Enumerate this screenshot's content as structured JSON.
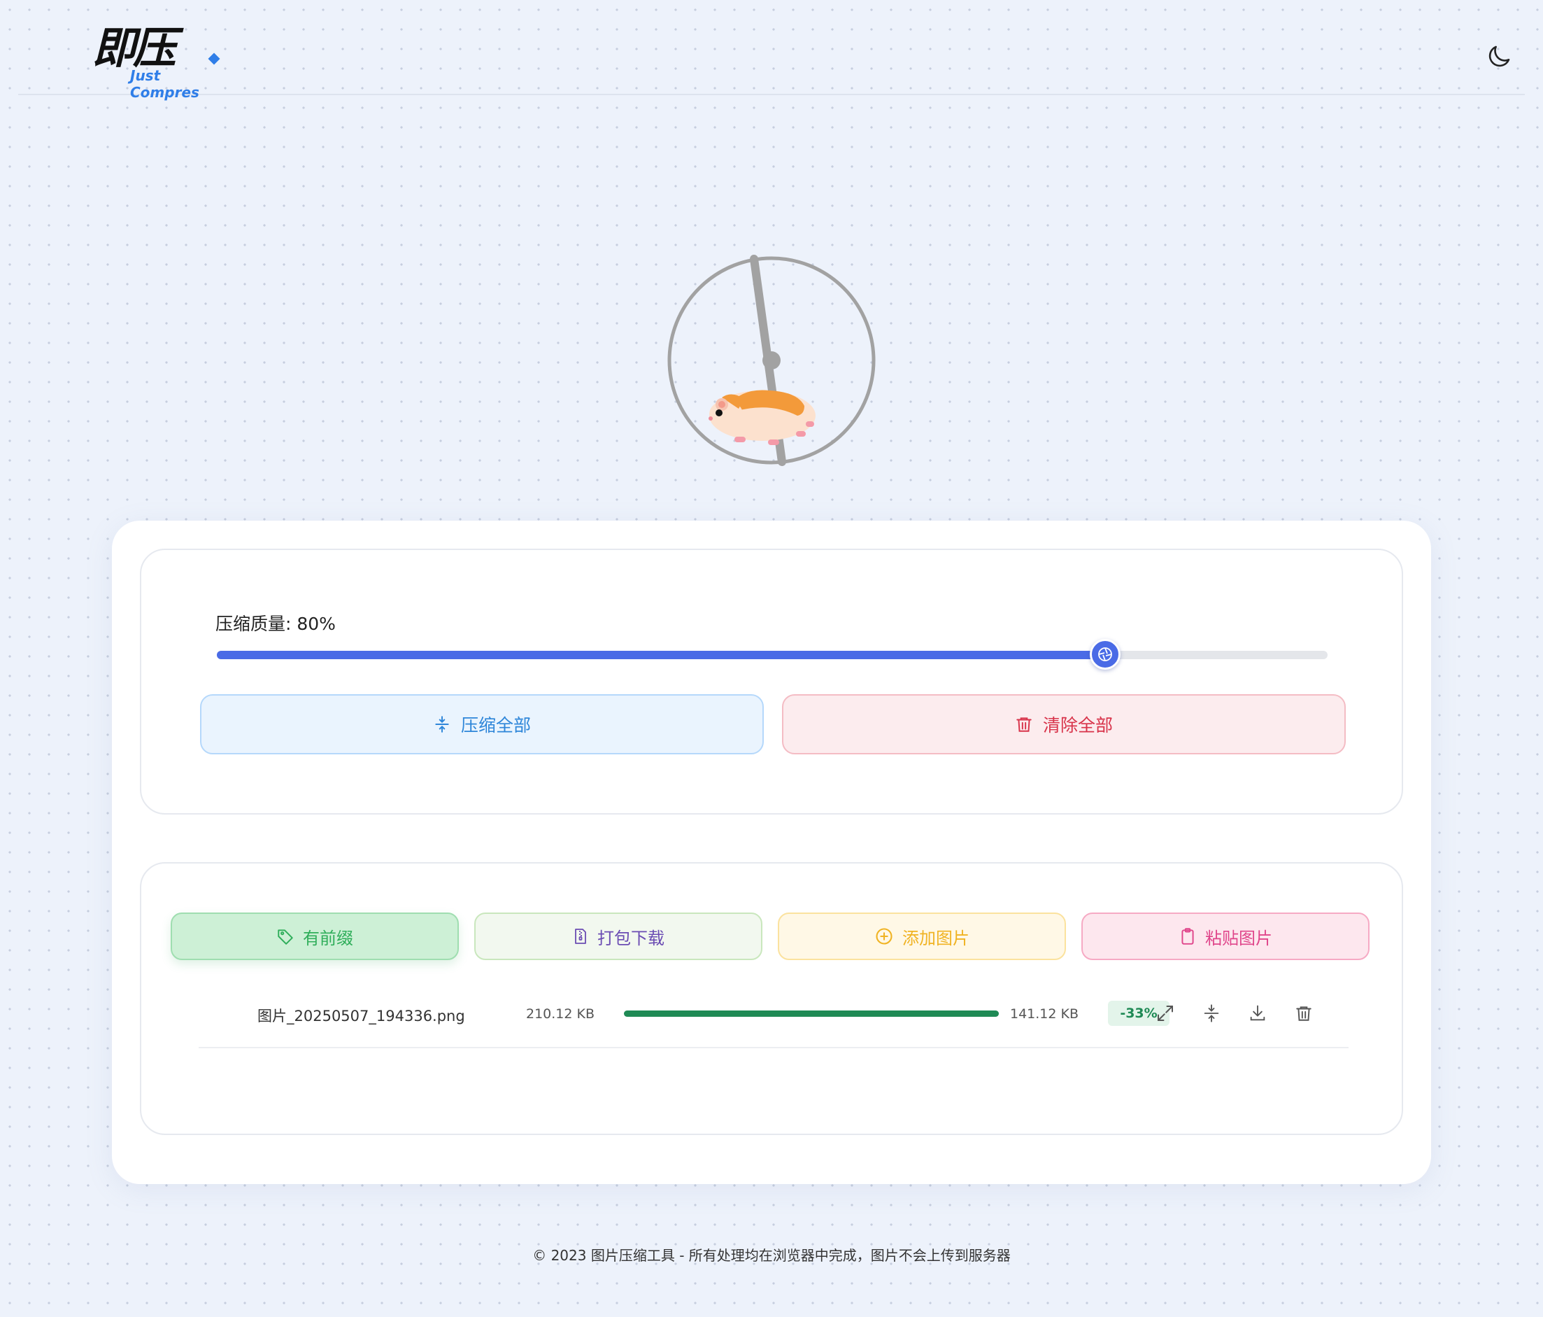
{
  "header": {
    "logo_main": "即压",
    "logo_sub": "Just Compres",
    "theme_toggle_icon": "moon-icon"
  },
  "quality": {
    "label": "压缩质量: 80%",
    "value": 80,
    "min": 0,
    "max": 100,
    "accent": "#4a6be6"
  },
  "actions": {
    "compress_all": "压缩全部",
    "clear_all": "清除全部"
  },
  "toolbar": {
    "prefix": "有前缀",
    "pack_download": "打包下载",
    "add_image": "添加图片",
    "paste_image": "粘贴图片"
  },
  "files": [
    {
      "name": "图片_20250507_194336.png",
      "original_size": "210.12 KB",
      "progress": 1.0,
      "compressed_size": "141.12 KB",
      "ratio": "-33%"
    }
  ],
  "footer": {
    "text": "© 2023 图片压缩工具 - 所有处理均在浏览器中完成，图片不会上传到服务器"
  }
}
